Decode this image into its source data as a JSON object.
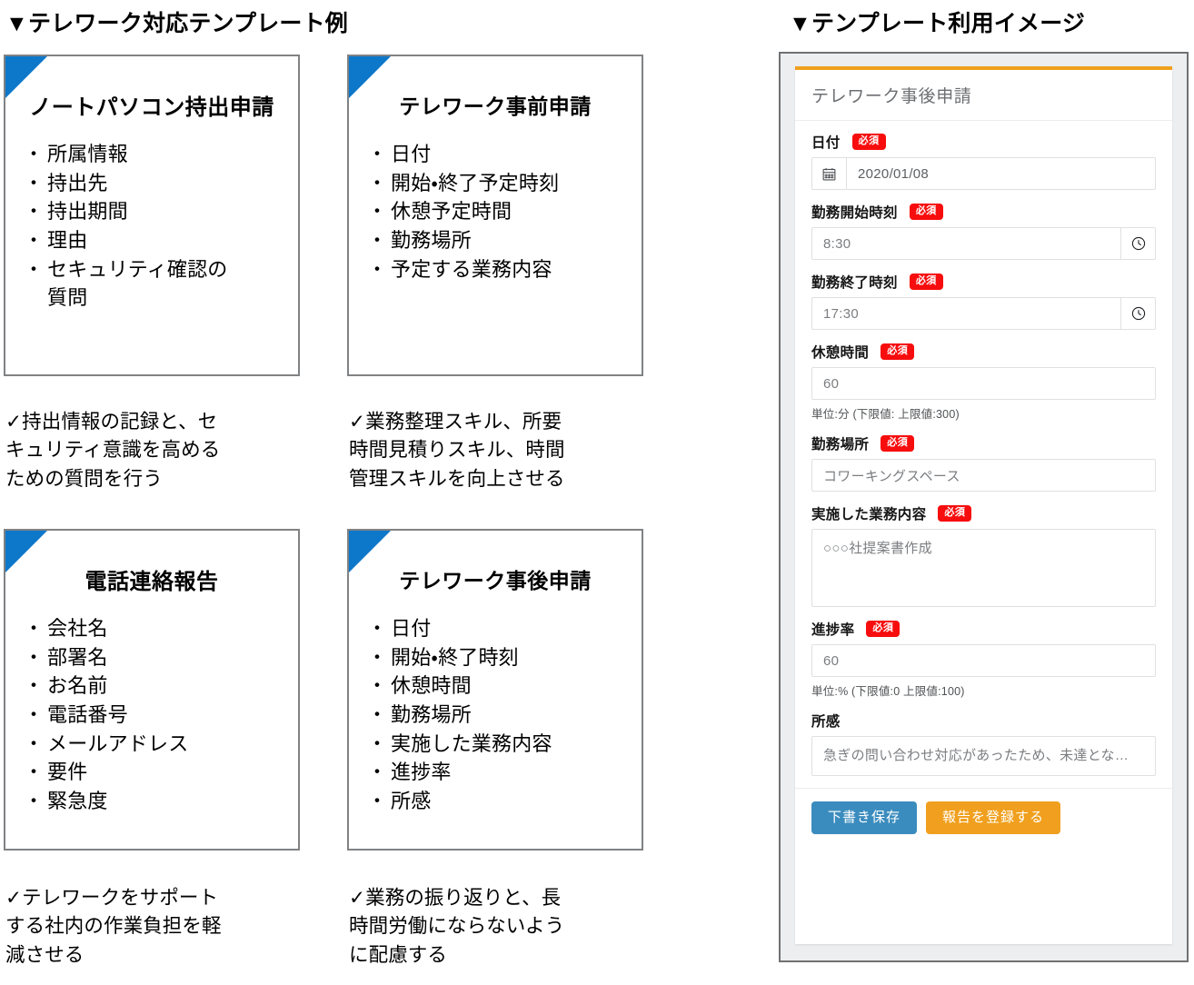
{
  "headings": {
    "left": "▼テレワーク対応テンプレート例",
    "right": "▼テンプレート利用イメージ"
  },
  "colors": {
    "corner_flag_blue": "#0d77c9",
    "card_border_gray": "#808284",
    "accent_orange": "#f0a01e",
    "required_red": "#f70d0d",
    "secondary_blue": "#3b8cbe",
    "device_bg": "#eceef0"
  },
  "templates": [
    {
      "title": "ノートパソコン持出申請",
      "items": [
        "所属情報",
        "持出先",
        "持出期間",
        "理由",
        "セキュリティ確認の\n質問"
      ],
      "caption_check": "✓",
      "caption": "持出情報の記録と、セ\nキュリティ意識を高める\nための質問を行う"
    },
    {
      "title": "テレワーク事前申請",
      "items": [
        "日付",
        "開始・終了予定時刻",
        "休憩予定時間",
        "勤務場所",
        "予定する業務内容"
      ],
      "caption_check": "✓",
      "caption": "業務整理スキル、所要\n時間見積りスキル、時間\n管理スキルを向上させる"
    },
    {
      "title": "電話連絡報告",
      "items": [
        "会社名",
        "部署名",
        "お名前",
        "電話番号",
        "メールアドレス",
        "要件",
        "緊急度"
      ],
      "caption_check": "✓",
      "caption": "テレワークをサポート\nする社内の作業負担を軽\n減させる"
    },
    {
      "title": "テレワーク事後申請",
      "items": [
        "日付",
        "開始・終了時刻",
        "休憩時間",
        "勤務場所",
        "実施した業務内容",
        "進捗率",
        "所感"
      ],
      "caption_check": "✓",
      "caption": "業務の振り返りと、長\n時間労働にならないよう\nに配慮する"
    }
  ],
  "form": {
    "title": "テレワーク事後申請",
    "required_badge": "必須",
    "fields": [
      {
        "label": "日付",
        "required": true,
        "value": "2020/01/08",
        "icon": "calendar-icon",
        "icon_side": "left",
        "hint": ""
      },
      {
        "label": "勤務開始時刻",
        "required": true,
        "value": "8:30",
        "icon": "clock-icon",
        "icon_side": "right",
        "hint": ""
      },
      {
        "label": "勤務終了時刻",
        "required": true,
        "value": "17:30",
        "icon": "clock-icon",
        "icon_side": "right",
        "hint": ""
      },
      {
        "label": "休憩時間",
        "required": true,
        "value": "60",
        "icon": "",
        "icon_side": "",
        "hint": "単位:分 (下限値:  上限値:300)"
      },
      {
        "label": "勤務場所",
        "required": true,
        "value": "コワーキングスペース",
        "icon": "",
        "icon_side": "",
        "hint": ""
      },
      {
        "label": "実施した業務内容",
        "required": true,
        "value": "○○○社提案書作成",
        "icon": "",
        "icon_side": "",
        "hint": ""
      },
      {
        "label": "進捗率",
        "required": true,
        "value": "60",
        "icon": "",
        "icon_side": "",
        "hint": "単位:% (下限値:0  上限値:100)"
      },
      {
        "label": "所感",
        "required": false,
        "value": "急ぎの問い合わせ対応があったため、未達とな…",
        "icon": "",
        "icon_side": "",
        "hint": ""
      }
    ],
    "buttons": {
      "draft": "下書き保存",
      "submit": "報告を登録する"
    }
  }
}
